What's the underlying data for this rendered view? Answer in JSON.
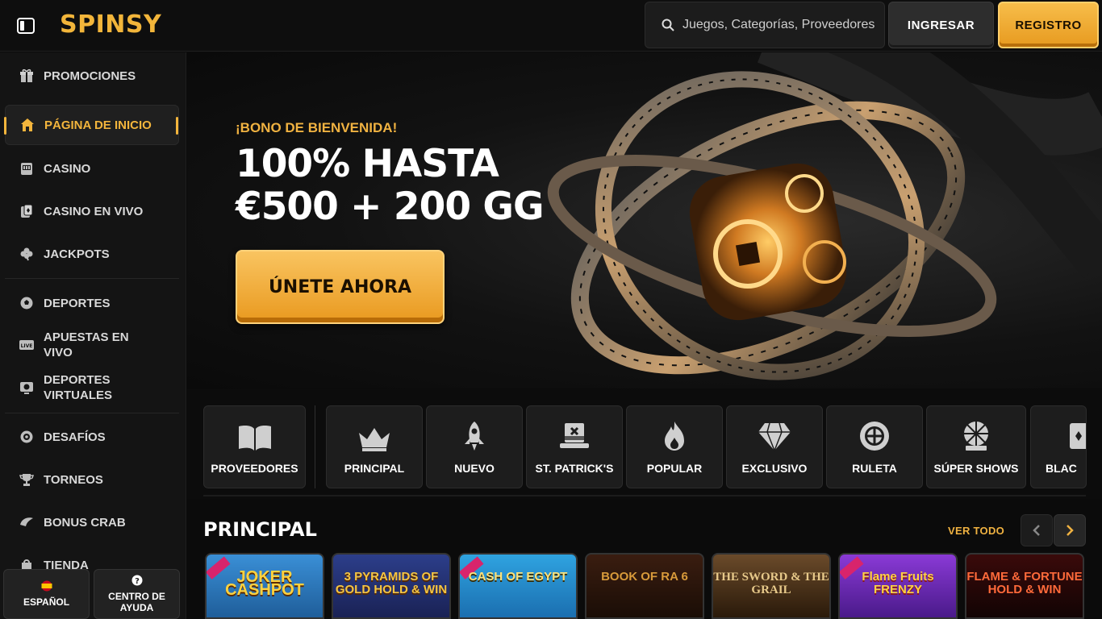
{
  "brand": {
    "name": "SPINSY",
    "accent": "#f2b53a"
  },
  "header": {
    "search_placeholder": "Juegos, Categorías, Proveedores",
    "login_label": "INGRESAR",
    "register_label": "REGISTRO"
  },
  "sidebar": {
    "items": [
      {
        "label": "PROMOCIONES",
        "icon": "gift-icon"
      },
      {
        "label": "PÁGINA DE INICIO",
        "icon": "home-icon",
        "active": true
      },
      {
        "label": "CASINO",
        "icon": "slot-machine-icon"
      },
      {
        "label": "CASINO EN VIVO",
        "icon": "live-cards-icon"
      },
      {
        "label": "JACKPOTS",
        "icon": "clover-icon"
      },
      {
        "label": "DEPORTES",
        "icon": "soccer-ball-icon"
      },
      {
        "label": "APUESTAS EN VIVO",
        "icon": "live-badge-icon"
      },
      {
        "label": "DEPORTES VIRTUALES",
        "icon": "virtual-sports-icon"
      },
      {
        "label": "DESAFÍOS",
        "icon": "challenge-icon"
      },
      {
        "label": "TORNEOS",
        "icon": "trophy-icon"
      },
      {
        "label": "BONUS CRAB",
        "icon": "claw-icon"
      },
      {
        "label": "TIENDA",
        "icon": "shop-icon"
      }
    ],
    "language_label": "ESPAÑOL",
    "help_label": "CENTRO DE AYUDA"
  },
  "hero": {
    "kicker": "¡BONO DE BIENVENIDA!",
    "title_line1": "100% HASTA",
    "title_line2": "€500 + 200 GG",
    "cta_label": "ÚNETE AHORA"
  },
  "categories": [
    {
      "label": "PROVEEDORES",
      "icon": "book-icon"
    },
    {
      "label": "PRINCIPAL",
      "icon": "crown-icon"
    },
    {
      "label": "NUEVO",
      "icon": "rocket-icon"
    },
    {
      "label": "ST. PATRICK'S",
      "icon": "leprechaun-hat-icon"
    },
    {
      "label": "POPULAR",
      "icon": "flame-icon"
    },
    {
      "label": "EXCLUSIVO",
      "icon": "diamond-icon"
    },
    {
      "label": "RULETA",
      "icon": "roulette-icon"
    },
    {
      "label": "SÚPER SHOWS",
      "icon": "wheel-show-icon"
    },
    {
      "label": "BLAC",
      "icon": "cards-icon"
    }
  ],
  "section": {
    "title": "PRINCIPAL",
    "see_all": "VER TODO"
  },
  "games": [
    {
      "title": "JOKER CASHPOT",
      "exclusive": true
    },
    {
      "title": "3 PYRAMIDS OF GOLD HOLD & WIN",
      "exclusive": false
    },
    {
      "title": "CASH OF EGYPT",
      "exclusive": true
    },
    {
      "title": "BOOK OF RA 6",
      "exclusive": false
    },
    {
      "title": "THE SWORD & THE GRAIL",
      "exclusive": false
    },
    {
      "title": "Flame Fruits FRENZY",
      "exclusive": true
    },
    {
      "title": "FLAME & FORTUNE HOLD & WIN",
      "exclusive": false
    }
  ]
}
